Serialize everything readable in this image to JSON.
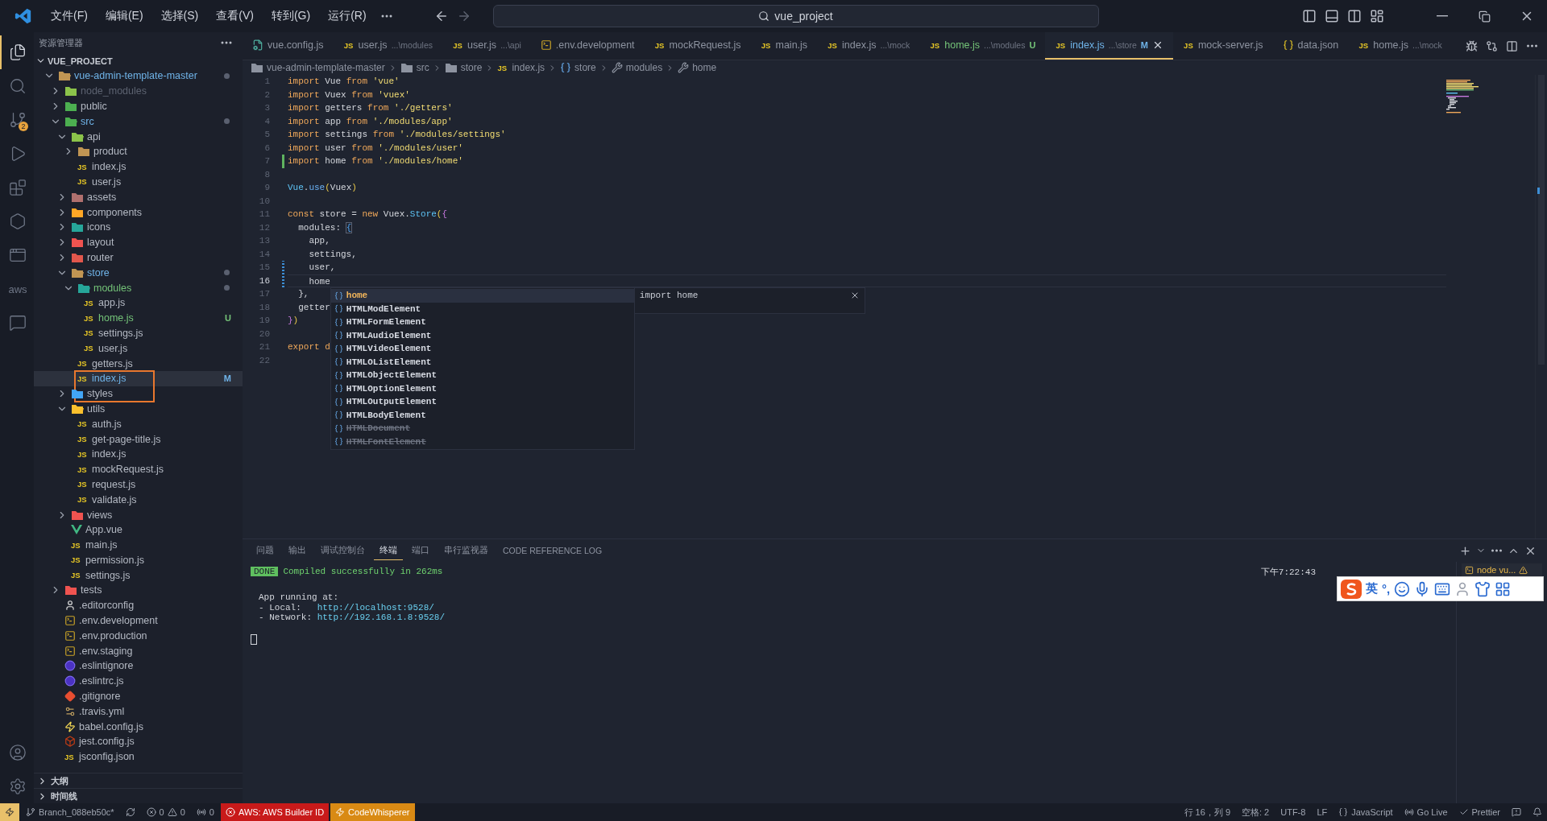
{
  "title_bar": {
    "menus": [
      "文件(F)",
      "编辑(E)",
      "选择(S)",
      "查看(V)",
      "转到(G)",
      "运行(R)"
    ],
    "search": {
      "value": "vue_project"
    }
  },
  "activity_bar": {
    "items": [
      {
        "kind": "explorer",
        "selected": true
      },
      {
        "kind": "search",
        "selected": false
      },
      {
        "kind": "source-control",
        "selected": false,
        "badge": "2"
      },
      {
        "kind": "run",
        "selected": false
      },
      {
        "kind": "extensions",
        "selected": false
      },
      {
        "kind": "hexagon",
        "selected": false
      },
      {
        "kind": "browser",
        "selected": false
      },
      {
        "kind": "aws",
        "selected": false,
        "label": "aws"
      },
      {
        "kind": "chat",
        "selected": false
      }
    ],
    "bottom": [
      {
        "kind": "account"
      },
      {
        "kind": "settings"
      }
    ]
  },
  "explorer": {
    "title": "资源管理器",
    "project": "VUE_PROJECT",
    "items": [
      {
        "name": "vue-admin-template-master",
        "kind": "folder",
        "icon": {
          "color": "#c09553"
        },
        "expanded": true,
        "selected": false,
        "color": "#6fb3e8",
        "dot": true,
        "children": [
          {
            "name": "node_modules",
            "kind": "folder",
            "icon": {
              "color": "#8bc34a"
            },
            "expanded": false,
            "selected": false,
            "color": "#5c6270"
          },
          {
            "name": "public",
            "kind": "folder",
            "icon": {
              "color": "#4caf50"
            },
            "expanded": false,
            "selected": false
          },
          {
            "name": "src",
            "kind": "folder",
            "icon": {
              "color": "#4caf50"
            },
            "expanded": true,
            "selected": false,
            "color": "#6fb3e8",
            "dot": true,
            "children": [
              {
                "name": "api",
                "kind": "folder",
                "icon": {
                  "color": "#8bc34a"
                },
                "expanded": true,
                "selected": false,
                "children": [
                  {
                    "name": "product",
                    "kind": "folder",
                    "icon": {
                      "color": "#c09553"
                    },
                    "expanded": false,
                    "selected": false
                  },
                  {
                    "name": "index.js",
                    "kind": "js",
                    "icon_text": "JS",
                    "selected": false
                  },
                  {
                    "name": "user.js",
                    "kind": "js",
                    "icon_text": "JS",
                    "selected": false
                  }
                ]
              },
              {
                "name": "assets",
                "kind": "folder",
                "icon": {
                  "color": "#b0706e"
                },
                "expanded": false,
                "selected": false
              },
              {
                "name": "components",
                "kind": "folder",
                "icon": {
                  "color": "#ffa726"
                },
                "expanded": false,
                "selected": false
              },
              {
                "name": "icons",
                "kind": "folder",
                "icon": {
                  "color": "#26a69a"
                },
                "expanded": false,
                "selected": false
              },
              {
                "name": "layout",
                "kind": "folder",
                "icon": {
                  "color": "#ef5350"
                },
                "expanded": false,
                "selected": false
              },
              {
                "name": "router",
                "kind": "folder",
                "icon": {
                  "color": "#e2574c"
                },
                "expanded": false,
                "selected": false
              },
              {
                "name": "store",
                "kind": "folder",
                "icon": {
                  "color": "#c09553"
                },
                "expanded": true,
                "selected": false,
                "color": "#6fb3e8",
                "dot": true,
                "children": [
                  {
                    "name": "modules",
                    "kind": "folder",
                    "icon": {
                      "color": "#26a69a"
                    },
                    "expanded": true,
                    "selected": false,
                    "color": "#74c378",
                    "dot": true,
                    "children": [
                      {
                        "name": "app.js",
                        "kind": "js",
                        "icon_text": "JS",
                        "selected": false
                      },
                      {
                        "name": "home.js",
                        "kind": "js",
                        "icon_text": "JS",
                        "selected": false,
                        "color": "#74c378",
                        "badge": "U"
                      },
                      {
                        "name": "settings.js",
                        "kind": "js",
                        "icon_text": "JS",
                        "selected": false
                      },
                      {
                        "name": "user.js",
                        "kind": "js",
                        "icon_text": "JS",
                        "selected": false
                      }
                    ]
                  },
                  {
                    "name": "getters.js",
                    "kind": "js",
                    "icon_text": "JS",
                    "selected": false
                  },
                  {
                    "name": "index.js",
                    "kind": "js",
                    "icon_text": "JS",
                    "selected": true,
                    "color": "#6fb3e8",
                    "badge": "M",
                    "outlined": true
                  }
                ]
              },
              {
                "name": "styles",
                "kind": "folder",
                "icon": {
                  "color": "#42a5f5"
                },
                "expanded": false,
                "selected": false
              },
              {
                "name": "utils",
                "kind": "folder",
                "icon": {
                  "color": "#fbc02d"
                },
                "expanded": true,
                "selected": false,
                "children": [
                  {
                    "name": "auth.js",
                    "kind": "js",
                    "icon_text": "JS",
                    "selected": false
                  },
                  {
                    "name": "get-page-title.js",
                    "kind": "js",
                    "icon_text": "JS",
                    "selected": false
                  },
                  {
                    "name": "index.js",
                    "kind": "js",
                    "icon_text": "JS",
                    "selected": false
                  },
                  {
                    "name": "mockRequest.js",
                    "kind": "js",
                    "icon_text": "JS",
                    "selected": false
                  },
                  {
                    "name": "request.js",
                    "kind": "js",
                    "icon_text": "JS",
                    "selected": false
                  },
                  {
                    "name": "validate.js",
                    "kind": "js",
                    "icon_text": "JS",
                    "selected": false
                  }
                ]
              },
              {
                "name": "views",
                "kind": "folder",
                "icon": {
                  "color": "#ef5350"
                },
                "expanded": false,
                "selected": false
              },
              {
                "name": "App.vue",
                "kind": "vue",
                "selected": false
              },
              {
                "name": "main.js",
                "kind": "js",
                "icon_text": "JS",
                "selected": false
              },
              {
                "name": "permission.js",
                "kind": "js",
                "icon_text": "JS",
                "selected": false
              },
              {
                "name": "settings.js",
                "kind": "js",
                "icon_text": "JS",
                "selected": false
              }
            ]
          },
          {
            "name": "tests",
            "kind": "folder",
            "icon": {
              "color": "#ef5350"
            },
            "expanded": false,
            "selected": false
          },
          {
            "name": ".editorconfig",
            "kind": "editorconfig",
            "selected": false
          },
          {
            "name": ".env.development",
            "kind": "env",
            "selected": false
          },
          {
            "name": ".env.production",
            "kind": "env",
            "selected": false
          },
          {
            "name": ".env.staging",
            "kind": "env",
            "selected": false
          },
          {
            "name": ".eslintignore",
            "kind": "eslint",
            "selected": false
          },
          {
            "name": ".eslintrc.js",
            "kind": "eslint",
            "selected": false
          },
          {
            "name": ".gitignore",
            "kind": "git",
            "selected": false
          },
          {
            "name": ".travis.yml",
            "kind": "yml",
            "selected": false
          },
          {
            "name": "babel.config.js",
            "kind": "babel",
            "selected": false
          },
          {
            "name": "jest.config.js",
            "kind": "jest",
            "selected": false
          },
          {
            "name": "jsconfig.json",
            "kind": "js",
            "icon_text": "JS",
            "selected": false
          }
        ]
      }
    ],
    "sections": [
      "大纲",
      "时间线"
    ]
  },
  "tabs": [
    {
      "label": "vue.config.js",
      "kind": "config",
      "selected": false
    },
    {
      "label": "user.js",
      "detail": "...\\modules",
      "kind": "js",
      "icon_text": "JS",
      "selected": false
    },
    {
      "label": "user.js",
      "detail": "...\\api",
      "kind": "js",
      "icon_text": "JS",
      "selected": false
    },
    {
      "label": ".env.development",
      "kind": "env",
      "selected": false
    },
    {
      "label": "mockRequest.js",
      "kind": "js",
      "icon_text": "JS",
      "selected": false
    },
    {
      "label": "main.js",
      "kind": "js",
      "icon_text": "JS",
      "selected": false
    },
    {
      "label": "index.js",
      "detail": "...\\mock",
      "kind": "js",
      "icon_text": "JS",
      "selected": false
    },
    {
      "label": "home.js",
      "detail": "...\\modules",
      "kind": "js",
      "icon_text": "JS",
      "selected": false,
      "color": "#74c378",
      "badge": "U"
    },
    {
      "label": "index.js",
      "detail": "...\\store",
      "kind": "js",
      "icon_text": "JS",
      "selected": true,
      "color": "#6fb3e8",
      "badge": "M"
    },
    {
      "label": "mock-server.js",
      "kind": "js",
      "icon_text": "JS",
      "selected": false
    },
    {
      "label": "data.json",
      "kind": "json",
      "selected": false
    },
    {
      "label": "home.js",
      "detail": "...\\mock",
      "kind": "js",
      "icon_text": "JS",
      "selected": false
    }
  ],
  "breadcrumb": [
    {
      "label": "vue-admin-template-master",
      "kind": "folder"
    },
    {
      "label": "src",
      "kind": "folder"
    },
    {
      "label": "store",
      "kind": "folder"
    },
    {
      "label": "index.js",
      "kind": "js",
      "icon_text": "JS"
    },
    {
      "label": "store",
      "kind": "variable"
    },
    {
      "label": "modules",
      "kind": "property"
    },
    {
      "label": "home",
      "kind": "property"
    }
  ],
  "editor": {
    "lines": [
      {
        "number": "1",
        "tokens": [
          {
            "kind": "keyword",
            "text": "import "
          },
          {
            "kind": "plain",
            "text": "Vue "
          },
          {
            "kind": "keyword",
            "text": "from "
          },
          {
            "kind": "string",
            "text": "'vue'"
          }
        ]
      },
      {
        "number": "2",
        "tokens": [
          {
            "kind": "keyword",
            "text": "import "
          },
          {
            "kind": "plain",
            "text": "Vuex "
          },
          {
            "kind": "keyword",
            "text": "from "
          },
          {
            "kind": "string",
            "text": "'vuex'"
          }
        ]
      },
      {
        "number": "3",
        "tokens": [
          {
            "kind": "keyword",
            "text": "import "
          },
          {
            "kind": "plain",
            "text": "getters "
          },
          {
            "kind": "keyword",
            "text": "from "
          },
          {
            "kind": "string",
            "text": "'./getters'"
          }
        ]
      },
      {
        "number": "4",
        "tokens": [
          {
            "kind": "keyword",
            "text": "import "
          },
          {
            "kind": "plain",
            "text": "app "
          },
          {
            "kind": "keyword",
            "text": "from "
          },
          {
            "kind": "string",
            "text": "'./modules/app'"
          }
        ]
      },
      {
        "number": "5",
        "tokens": [
          {
            "kind": "keyword",
            "text": "import "
          },
          {
            "kind": "plain",
            "text": "settings "
          },
          {
            "kind": "keyword",
            "text": "from "
          },
          {
            "kind": "string",
            "text": "'./modules/settings'"
          }
        ]
      },
      {
        "number": "6",
        "tokens": [
          {
            "kind": "keyword",
            "text": "import "
          },
          {
            "kind": "plain",
            "text": "user "
          },
          {
            "kind": "keyword",
            "text": "from "
          },
          {
            "kind": "string",
            "text": "'./modules/user'"
          }
        ]
      },
      {
        "number": "7",
        "kind": "added",
        "tokens": [
          {
            "kind": "keyword",
            "text": "import "
          },
          {
            "kind": "plain",
            "text": "home "
          },
          {
            "kind": "keyword",
            "text": "from "
          },
          {
            "kind": "string",
            "text": "'./modules/home'"
          }
        ]
      },
      {
        "number": "8"
      },
      {
        "number": "9",
        "tokens": [
          {
            "kind": "class",
            "text": "Vue"
          },
          {
            "kind": "plain",
            "text": "."
          },
          {
            "kind": "function",
            "text": "use"
          },
          {
            "kind": "paren",
            "text": "("
          },
          {
            "kind": "plain",
            "text": "Vuex"
          },
          {
            "kind": "paren",
            "text": ")"
          }
        ]
      },
      {
        "number": "10"
      },
      {
        "number": "11",
        "tokens": [
          {
            "kind": "keyword",
            "text": "const "
          },
          {
            "kind": "plain",
            "text": "store = "
          },
          {
            "kind": "keyword",
            "text": "new "
          },
          {
            "kind": "plain",
            "text": "Vuex."
          },
          {
            "kind": "class",
            "text": "Store"
          },
          {
            "kind": "paren",
            "text": "("
          },
          {
            "kind": "brace",
            "text": "{"
          }
        ]
      },
      {
        "number": "12",
        "tokens": [
          {
            "kind": "plain",
            "text": "  modules: "
          },
          {
            "kind": "match",
            "text": "{"
          }
        ]
      },
      {
        "number": "13",
        "tokens": [
          {
            "kind": "plain",
            "text": "    app,"
          }
        ]
      },
      {
        "number": "14",
        "tokens": [
          {
            "kind": "plain",
            "text": "    settings,"
          }
        ]
      },
      {
        "number": "15",
        "kind": "modified",
        "tokens": [
          {
            "kind": "plain",
            "text": "    user,"
          }
        ]
      },
      {
        "number": "16",
        "kind": "modified",
        "current": true,
        "tokens": [
          {
            "kind": "plain",
            "text": "    home"
          }
        ]
      },
      {
        "number": "17",
        "tokens": [
          {
            "kind": "plain",
            "text": "  },"
          }
        ]
      },
      {
        "number": "18",
        "tokens": [
          {
            "kind": "plain",
            "text": "  getter"
          }
        ]
      },
      {
        "number": "19",
        "tokens": [
          {
            "kind": "brace",
            "text": "}"
          },
          {
            "kind": "paren",
            "text": ")"
          }
        ]
      },
      {
        "number": "20"
      },
      {
        "number": "21",
        "tokens": [
          {
            "kind": "keyword",
            "text": "export d"
          }
        ]
      },
      {
        "number": "22"
      }
    ],
    "suggest": {
      "items": [
        {
          "label": "home",
          "selected": true
        },
        {
          "label": "HTMLModElement",
          "selected": false
        },
        {
          "label": "HTMLFormElement",
          "selected": false
        },
        {
          "label": "HTMLAudioElement",
          "selected": false
        },
        {
          "label": "HTMLVideoElement",
          "selected": false
        },
        {
          "label": "HTMLOListElement",
          "selected": false
        },
        {
          "label": "HTMLObjectElement",
          "selected": false
        },
        {
          "label": "HTMLOptionElement",
          "selected": false
        },
        {
          "label": "HTMLOutputElement",
          "selected": false
        },
        {
          "label": "HTMLBodyElement",
          "selected": false
        },
        {
          "label": "HTMLDocument",
          "selected": false,
          "deprecated": true
        },
        {
          "label": "HTMLFontElement",
          "selected": false,
          "deprecated": true
        }
      ],
      "detail": "import home"
    }
  },
  "panel": {
    "tabs": [
      {
        "label": "问题",
        "selected": false
      },
      {
        "label": "输出",
        "selected": false
      },
      {
        "label": "调试控制台",
        "selected": false
      },
      {
        "label": "终端",
        "selected": true
      },
      {
        "label": "端口",
        "selected": false
      },
      {
        "label": "串行监视器",
        "selected": false
      },
      {
        "label": "CODE REFERENCE LOG",
        "selected": false
      }
    ],
    "terminal": {
      "badge": "DONE",
      "message": "Compiled successfully in 262ms",
      "timestamp": "下午7:22:43",
      "lines": [
        {
          "text": "App running at:"
        },
        {
          "text": "- Local:   ",
          "link": "http://localhost:9528/"
        },
        {
          "text": "- Network: ",
          "link": "http://192.168.1.8:9528/"
        }
      ]
    },
    "terminals": [
      {
        "label": "node vu...",
        "warning": true
      }
    ]
  },
  "ime": {
    "mode": "英",
    "punctuation": "°,"
  },
  "status_bar": {
    "left": [
      {
        "kind": "remote"
      },
      {
        "kind": "branch",
        "label": "Branch_088eb50c*"
      },
      {
        "kind": "sync"
      },
      {
        "kind": "problems",
        "errors": "0",
        "warnings": "0"
      },
      {
        "kind": "ports",
        "label": "0"
      },
      {
        "kind": "aws",
        "label": "AWS: AWS Builder ID"
      },
      {
        "kind": "codewhisperer",
        "label": "CodeWhisperer"
      }
    ],
    "right": [
      {
        "kind": "text",
        "label": "行 16，列 9"
      },
      {
        "kind": "text",
        "label": "空格: 2"
      },
      {
        "kind": "text",
        "label": "UTF-8"
      },
      {
        "kind": "text",
        "label": "LF"
      },
      {
        "kind": "language",
        "label": "JavaScript"
      },
      {
        "kind": "golive",
        "label": "Go Live"
      },
      {
        "kind": "prettier",
        "label": "Prettier"
      },
      {
        "kind": "feedback"
      },
      {
        "kind": "bell"
      }
    ]
  }
}
